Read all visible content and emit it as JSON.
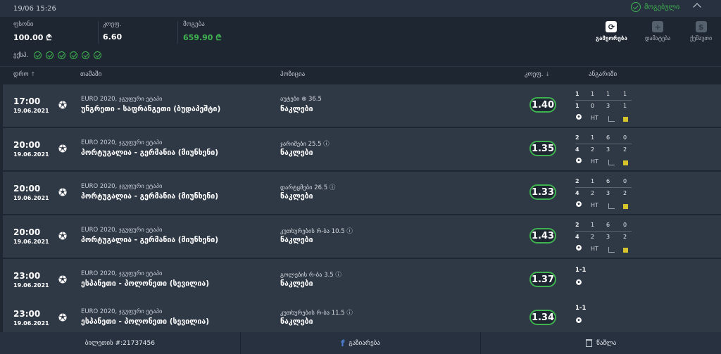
{
  "topbar": {
    "datetime": "19/06 15:26",
    "status_label": "მოგებული"
  },
  "summary": {
    "stake_label": "ფსონი",
    "stake_value": "100.00 ₾",
    "odds_label": "კოეფ.",
    "odds_value": "6.60",
    "win_label": "მოგება",
    "win_value": "659.90 ₾"
  },
  "tools": {
    "repeat_label": "გამეორება",
    "add_label": "დამატება",
    "cashout_label": "ქეშაუთი"
  },
  "express": {
    "label": "ექსპ.",
    "checks": 6
  },
  "table": {
    "col_date": "დრო",
    "col_game": "თამაში",
    "col_position": "პოზიცია",
    "col_odds": "კოეფ.",
    "col_calc": "ანგარიში"
  },
  "rows": [
    {
      "time": "17:00",
      "date": "19.06.2021",
      "tournament": "EURO 2020, ჯგუფური ეტაპი",
      "match": "უნგრეთი - საფრანგეთი (ბუდაპეშტი)",
      "market": "აუტები ⊗ 36.5",
      "selection": "ნაკლები",
      "odds": "1.40",
      "score_top": [
        "1",
        "1",
        "1",
        "1"
      ],
      "score_bot": [
        "1",
        "0",
        "3",
        "1"
      ],
      "ht_label": "HT",
      "simple": ""
    },
    {
      "time": "20:00",
      "date": "19.06.2021",
      "tournament": "EURO 2020, ჯგუფური ეტაპი",
      "match": "პორტუგალია - გერმანია (მიუნხენი)",
      "market": "ჯარიმები 25.5 ⓘ",
      "selection": "ნაკლები",
      "odds": "1.35",
      "score_top": [
        "2",
        "1",
        "6",
        "0"
      ],
      "score_bot": [
        "4",
        "2",
        "3",
        "2"
      ],
      "ht_label": "HT",
      "simple": ""
    },
    {
      "time": "20:00",
      "date": "19.06.2021",
      "tournament": "EURO 2020, ჯგუფური ეტაპი",
      "match": "პორტუგალია - გერმანია (მიუნხენი)",
      "market": "დარტყმები 26.5 ⓘ",
      "selection": "ნაკლები",
      "odds": "1.33",
      "score_top": [
        "2",
        "1",
        "6",
        "0"
      ],
      "score_bot": [
        "4",
        "2",
        "3",
        "2"
      ],
      "ht_label": "HT",
      "simple": ""
    },
    {
      "time": "20:00",
      "date": "19.06.2021",
      "tournament": "EURO 2020, ჯგუფური ეტაპი",
      "match": "პორტუგალია - გერმანია (მიუნხენი)",
      "market": "კუთხურების რ-ბა 10.5 ⓘ",
      "selection": "ნაკლები",
      "odds": "1.43",
      "score_top": [
        "2",
        "1",
        "6",
        "0"
      ],
      "score_bot": [
        "4",
        "2",
        "3",
        "2"
      ],
      "ht_label": "HT",
      "simple": ""
    },
    {
      "time": "23:00",
      "date": "19.06.2021",
      "tournament": "EURO 2020, ჯგუფური ეტაპი",
      "match": "ესპანეთი - პოლონეთი (სევილია)",
      "market": "გოლების რ-ბა 3.5 ⓘ",
      "selection": "ნაკლები",
      "odds": "1.37",
      "simple": "1-1"
    },
    {
      "time": "23:00",
      "date": "19.06.2021",
      "tournament": "EURO 2020, ჯგუფური ეტაპი",
      "match": "ესპანეთი - პოლონეთი (სევილია)",
      "market": "კუთხურების რ-ბა 11.5 ⓘ",
      "selection": "ნაკლები",
      "odds": "1.34",
      "simple": "1-1"
    }
  ],
  "footer": {
    "ticket_label": "ბილეთის #:21737456",
    "share_label": "გაზიარება",
    "delete_label": "წაშლა"
  },
  "colors": {
    "accent_green": "#3fb34f",
    "bg": "#1e2632",
    "row_bg": "#2f3946",
    "facebook": "#4a7cd1"
  }
}
